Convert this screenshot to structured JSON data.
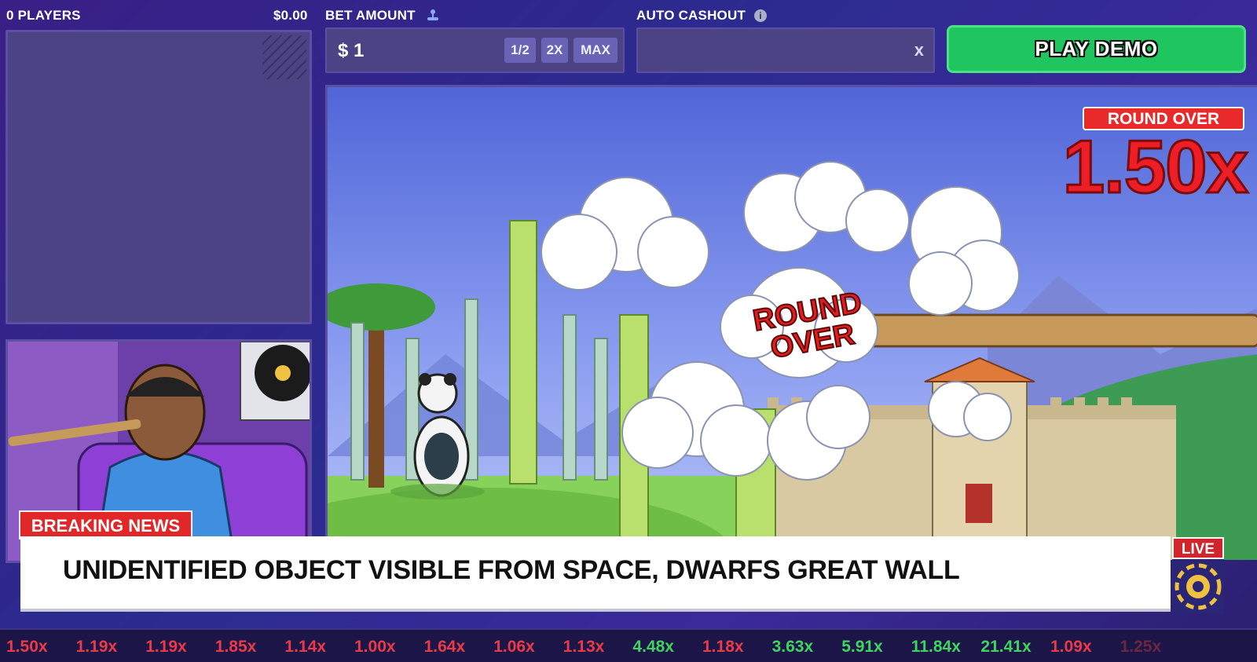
{
  "header": {
    "players_label": "0 PLAYERS",
    "players_total": "$0.00",
    "bet_label": "BET AMOUNT",
    "auto_label": "AUTO CASHOUT"
  },
  "bet": {
    "value": "$ 1",
    "half": "1/2",
    "double": "2X",
    "max": "MAX"
  },
  "auto": {
    "value": "",
    "clear": "x"
  },
  "play_button": "PLAY DEMO",
  "game": {
    "status_badge": "ROUND OVER",
    "multiplier": "1.50x",
    "cloud_text_1": "ROUND",
    "cloud_text_2": "OVER"
  },
  "news": {
    "tag": "BREAKING NEWS",
    "headline": "UNIDENTIFIED OBJECT VISIBLE FROM SPACE, DWARFS GREAT WALL",
    "live": "LIVE"
  },
  "history": [
    {
      "v": "1.50x",
      "c": "red"
    },
    {
      "v": "1.19x",
      "c": "red"
    },
    {
      "v": "1.19x",
      "c": "red"
    },
    {
      "v": "1.85x",
      "c": "red"
    },
    {
      "v": "1.14x",
      "c": "red"
    },
    {
      "v": "1.00x",
      "c": "red"
    },
    {
      "v": "1.64x",
      "c": "red"
    },
    {
      "v": "1.06x",
      "c": "red"
    },
    {
      "v": "1.13x",
      "c": "red"
    },
    {
      "v": "4.48x",
      "c": "green"
    },
    {
      "v": "1.18x",
      "c": "red"
    },
    {
      "v": "3.63x",
      "c": "green"
    },
    {
      "v": "5.91x",
      "c": "green"
    },
    {
      "v": "11.84x",
      "c": "green"
    },
    {
      "v": "21.41x",
      "c": "green"
    },
    {
      "v": "1.09x",
      "c": "red"
    },
    {
      "v": "1.25x",
      "c": "dim"
    }
  ],
  "colors": {
    "accent_green": "#1fc55f",
    "accent_red": "#e82a2a",
    "panel": "#4b4384"
  }
}
